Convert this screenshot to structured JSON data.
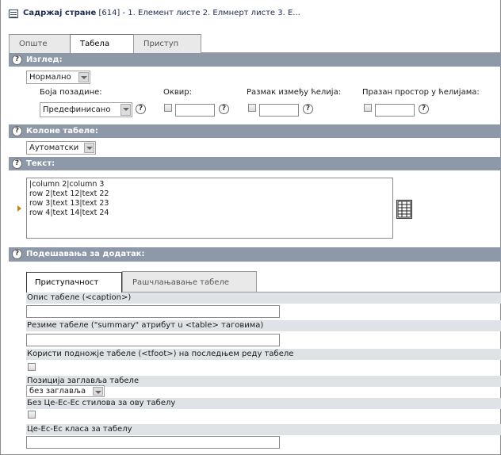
{
  "header": {
    "label": "Садржај стране",
    "rest": " [614] - 1. Елемент листе 2. Елмнерт листе 3. Е..."
  },
  "tabs": [
    "Опште",
    "Табела",
    "Приступ"
  ],
  "sections": {
    "appearance": "Изглед:",
    "columns": "Колоне табеле:",
    "text": "Текст:",
    "plugin": "Подешавања за додатак:"
  },
  "appearance": {
    "style_value": "Нормално",
    "bg_label": "Боја позадине:",
    "bg_value": "Предефинисано",
    "border_label": "Оквир:",
    "spacing_label": "Размак између ћелија:",
    "padding_label": "Празан простор у ћелијама:"
  },
  "columns": {
    "value": "Аутоматски"
  },
  "text": {
    "content": "|column 2|column 3\nrow 2|text 12|text 22\nrow 3|text 13|text 23\nrow 4|text 14|text 24"
  },
  "plugin": {
    "subtabs": [
      "Приступачност",
      "Рашчлањавање табеле"
    ],
    "caption_label": "Опис табеле (<caption>)",
    "summary_label": "Резиме табеле (\"summary\" атрибут u <table> таговима)",
    "tfoot_label": "Користи подножје табеле (<tfoot>) на последњем реду табеле",
    "header_pos_label": "Позиција заглавља табеле",
    "header_pos_value": "без заглавља",
    "nocss_label": "Без Це-Ес-Ес стилова за ову табелу",
    "cssclass_label": "Це-Ес-Ес класа за табелу"
  }
}
